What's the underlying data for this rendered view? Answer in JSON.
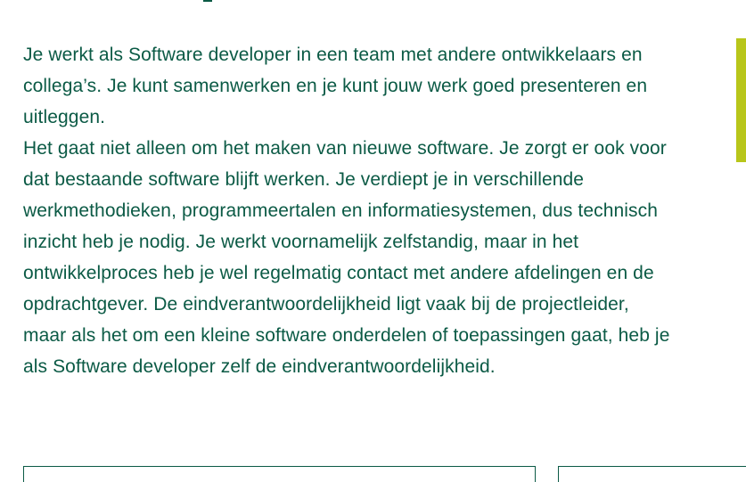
{
  "description": {
    "lines": [
      "Je werkt als Software developer in een team met andere ontwikkelaars en",
      "collega’s. Je kunt samenwerken en je kunt jouw werk goed presenteren en",
      "uitleggen.",
      "Het gaat niet alleen om het maken van nieuwe software. Je zorgt er ook voor",
      "dat bestaande software blijft werken. Je  verdiept je in verschillende",
      "werkmethodieken, programmeertalen en informatiesystemen, dus  technisch",
      "inzicht heb je nodig. Je werkt voornamelijk zelfstandig, maar in het",
      "ontwikkelproces heb je  wel regelmatig contact met andere afdelingen en de",
      "opdrachtgever. De eindverantwoordelijkheid ligt vaak bij de projectleider,",
      "maar als het om een kleine software onderdelen of toepassingen gaat, heb je",
      "als Software developer zelf de eindverantwoordelijkheid."
    ]
  },
  "colors": {
    "text": "#0b5a45",
    "accent": "#b8c61a",
    "background": "#ffffff"
  }
}
